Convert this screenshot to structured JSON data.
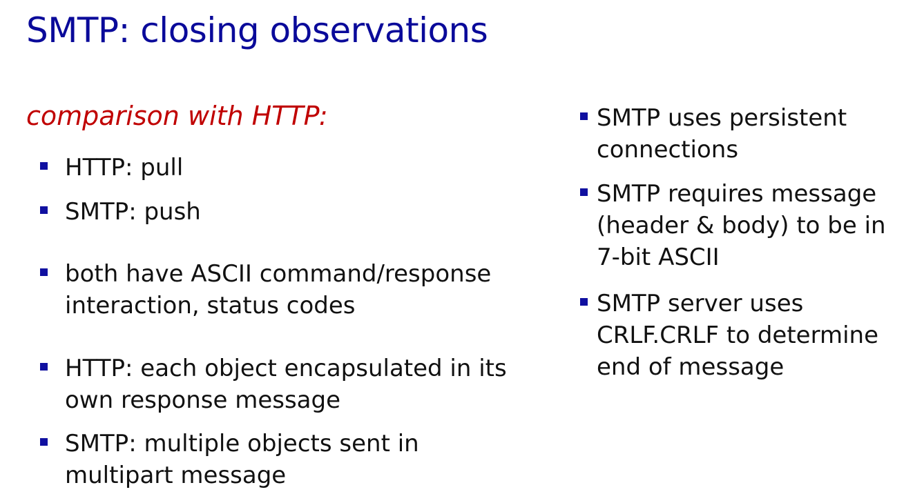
{
  "slide": {
    "title": "SMTP: closing observations",
    "subheading": "comparison with HTTP:",
    "left_bullets": [
      "HTTP: pull",
      "SMTP: push",
      "both have ASCII command/response\ninteraction, status codes",
      "HTTP: each object encapsulated in its\nown response message",
      "SMTP: multiple objects sent in\nmultipart message"
    ],
    "right_bullets": [
      "SMTP uses persistent\nconnections",
      "SMTP requires message\n(header & body) to be in\n7-bit ASCII",
      "SMTP server uses\nCRLF.CRLF to determine\nend of message"
    ]
  },
  "colors": {
    "title": "#0a0a9a",
    "subheading": "#c00000",
    "bullet_marker": "#1010a0",
    "text": "#111111"
  }
}
